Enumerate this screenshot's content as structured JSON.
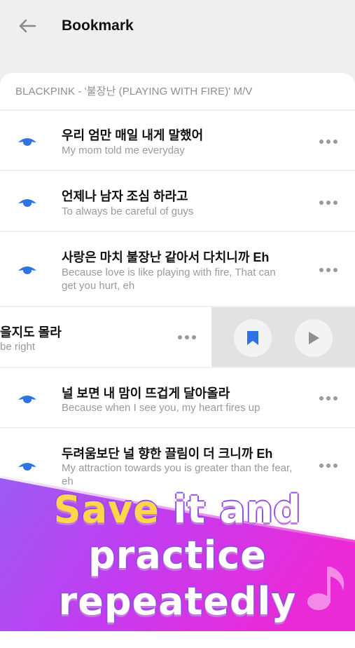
{
  "header": {
    "title": "Bookmark"
  },
  "card": {
    "title": "BLACKPINK - '불장난 (PLAYING WITH FIRE)' M/V"
  },
  "rows": [
    {
      "lyric": "우리 엄만 매일 내게 말했어",
      "translation": "My mom told me everyday"
    },
    {
      "lyric": "언제나 남자 조심 하라고",
      "translation": "To always be careful of guys"
    },
    {
      "lyric": "사랑은 마치 불장난 같아서 다치니까 Eh",
      "translation": "Because love is like playing with fire, That can get you hurt, eh"
    },
    {
      "lyric": "을지도 몰라",
      "translation": "be right"
    },
    {
      "lyric": "널 보면 내 맘이 뜨겁게 달아올라",
      "translation": "Because when I see you, my heart fires up"
    },
    {
      "lyric": "두려움보단 널 향한 끌림이 더 크니까 Eh",
      "translation": "My attraction towards you is greater than the fear, eh"
    }
  ],
  "promo": {
    "line1a": "Save",
    "line1b": "it and",
    "line2": "practice",
    "line3": "repeatedly"
  },
  "colors": {
    "accent": "#2f73e0",
    "promo_yellow": "#ffd54a",
    "promo_white": "#ffffff"
  }
}
